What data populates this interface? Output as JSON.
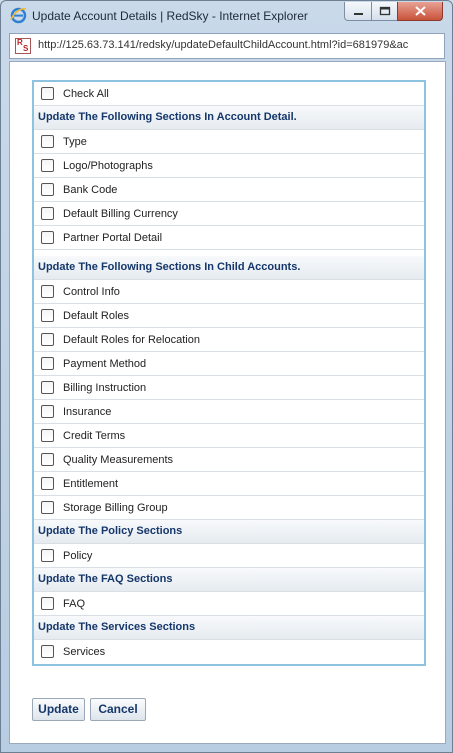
{
  "window": {
    "title": "Update Account Details | RedSky - Internet Explorer",
    "url": "http://125.63.73.141/redsky/updateDefaultChildAccount.html?id=681979&ac"
  },
  "check_all": {
    "label": "Check All"
  },
  "sections": [
    {
      "heading": "Update The Following Sections In Account Detail.",
      "items": [
        "Type",
        "Logo/Photographs",
        "Bank Code",
        "Default Billing Currency",
        "Partner Portal Detail"
      ]
    },
    {
      "heading": "Update The Following Sections In Child Accounts.",
      "items": [
        "Control Info",
        "Default Roles",
        "Default Roles for Relocation",
        "Payment Method",
        "Billing Instruction",
        "Insurance",
        "Credit Terms",
        "Quality Measurements",
        "Entitlement",
        "Storage Billing Group"
      ]
    },
    {
      "heading": "Update The Policy Sections",
      "items": [
        "Policy"
      ]
    },
    {
      "heading": "Update The FAQ Sections",
      "items": [
        "FAQ"
      ]
    },
    {
      "heading": "Update The Services Sections",
      "items": [
        "Services"
      ]
    }
  ],
  "buttons": {
    "update": "Update",
    "cancel": "Cancel"
  },
  "icons": {
    "browser": "internet-explorer-icon",
    "site": "redsky-favicon"
  }
}
